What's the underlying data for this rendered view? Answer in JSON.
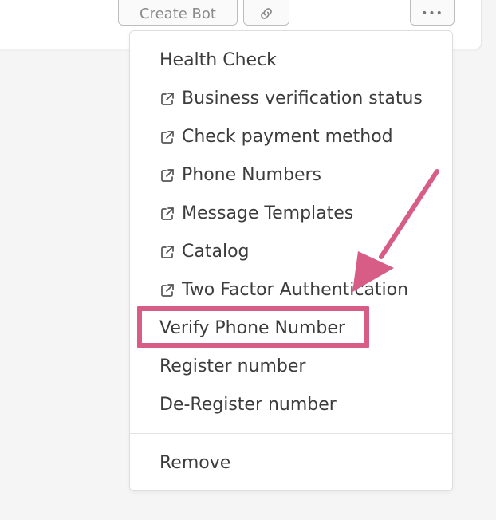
{
  "toolbar": {
    "create_bot_label": "Create Bot",
    "link_icon": "link-icon",
    "more_icon": "more-horizontal-icon",
    "more_label": "•••"
  },
  "menu": {
    "items": [
      {
        "label": "Health Check",
        "external": false,
        "icon": ""
      },
      {
        "label": "Business verification status",
        "external": true,
        "icon": "external-link-icon"
      },
      {
        "label": "Check payment method",
        "external": true,
        "icon": "external-link-icon"
      },
      {
        "label": "Phone Numbers",
        "external": true,
        "icon": "external-link-icon"
      },
      {
        "label": "Message Templates",
        "external": true,
        "icon": "external-link-icon"
      },
      {
        "label": "Catalog",
        "external": true,
        "icon": "external-link-icon"
      },
      {
        "label": "Two Factor Authentication",
        "external": true,
        "icon": "external-link-icon"
      },
      {
        "label": "Verify Phone Number",
        "external": false,
        "icon": ""
      },
      {
        "label": "Register number",
        "external": false,
        "icon": ""
      },
      {
        "label": "De-Register number",
        "external": false,
        "icon": ""
      }
    ],
    "remove_label": "Remove"
  },
  "annotation": {
    "highlight_color": "#d85d86",
    "arrow_color": "#d85d86"
  }
}
